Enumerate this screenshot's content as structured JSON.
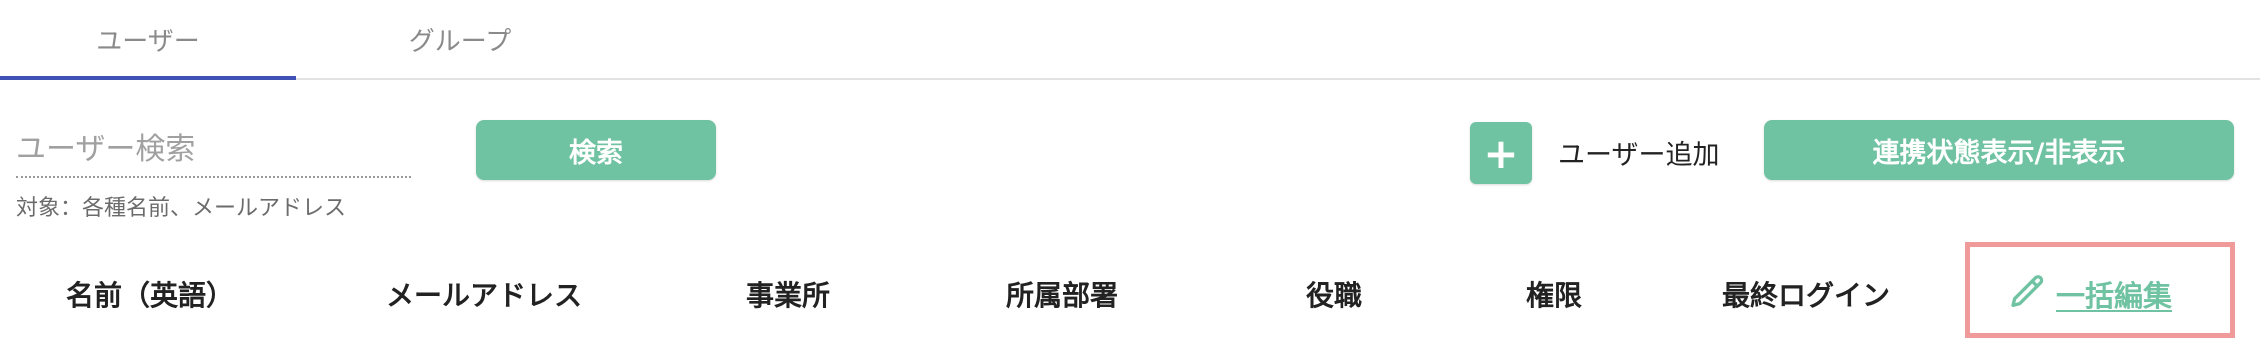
{
  "tabs": {
    "users": "ユーザー",
    "groups": "グループ"
  },
  "search": {
    "placeholder": "ユーザー検索",
    "hint": "対象：各種名前、メールアドレス",
    "button_label": "検索"
  },
  "actions": {
    "add_icon": "plus-icon",
    "add_user_label": "ユーザー追加",
    "toggle_link_label": "連携状態表示/非表示"
  },
  "table": {
    "columns": [
      "名前（英語）",
      "メールアドレス",
      "事業所",
      "所属部署",
      "役職",
      "権限",
      "最終ログイン"
    ],
    "bulk_edit_label": "一括編集",
    "bulk_edit_icon": "pencil-icon"
  },
  "colors": {
    "accent": "#70c3a2",
    "tab_indicator": "#3f51b5",
    "highlight_border": "#f19a9a"
  }
}
